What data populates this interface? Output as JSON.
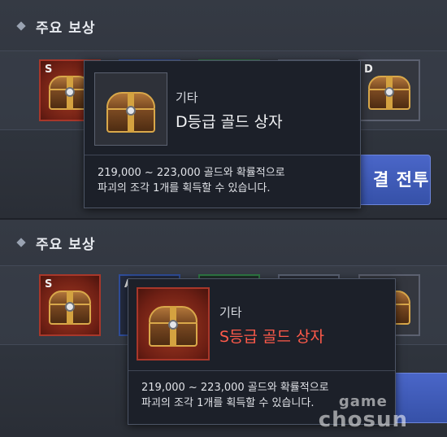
{
  "top": {
    "section_title": "주요 보상",
    "slots": [
      {
        "grade": "S"
      },
      {
        "grade": ""
      },
      {
        "grade": ""
      },
      {
        "grade": ""
      },
      {
        "grade": "D"
      }
    ],
    "battle_button_label": "결 전투",
    "tooltip": {
      "category": "기타",
      "item_name": "D등급 골드 상자",
      "desc_line1": "219,000 ~ 223,000 골드와 확률적으로",
      "desc_line2": "파괴의 조각 1개를 획득할 수 있습니다."
    }
  },
  "bottom": {
    "section_title": "주요 보상",
    "slots": [
      {
        "grade": "S"
      },
      {
        "grade": "A"
      },
      {
        "grade": ""
      },
      {
        "grade": ""
      },
      {
        "grade": ""
      }
    ],
    "tooltip": {
      "category": "기타",
      "item_name": "S등급 골드 상자",
      "name_color": "#ff5a4a",
      "desc_line1": "219,000 ~ 223,000 골드와 확률적으로",
      "desc_line2": "파괴의 조각 1개를 획득할 수 있습니다."
    }
  },
  "watermark": {
    "line1": "game",
    "line2": "chosun"
  }
}
